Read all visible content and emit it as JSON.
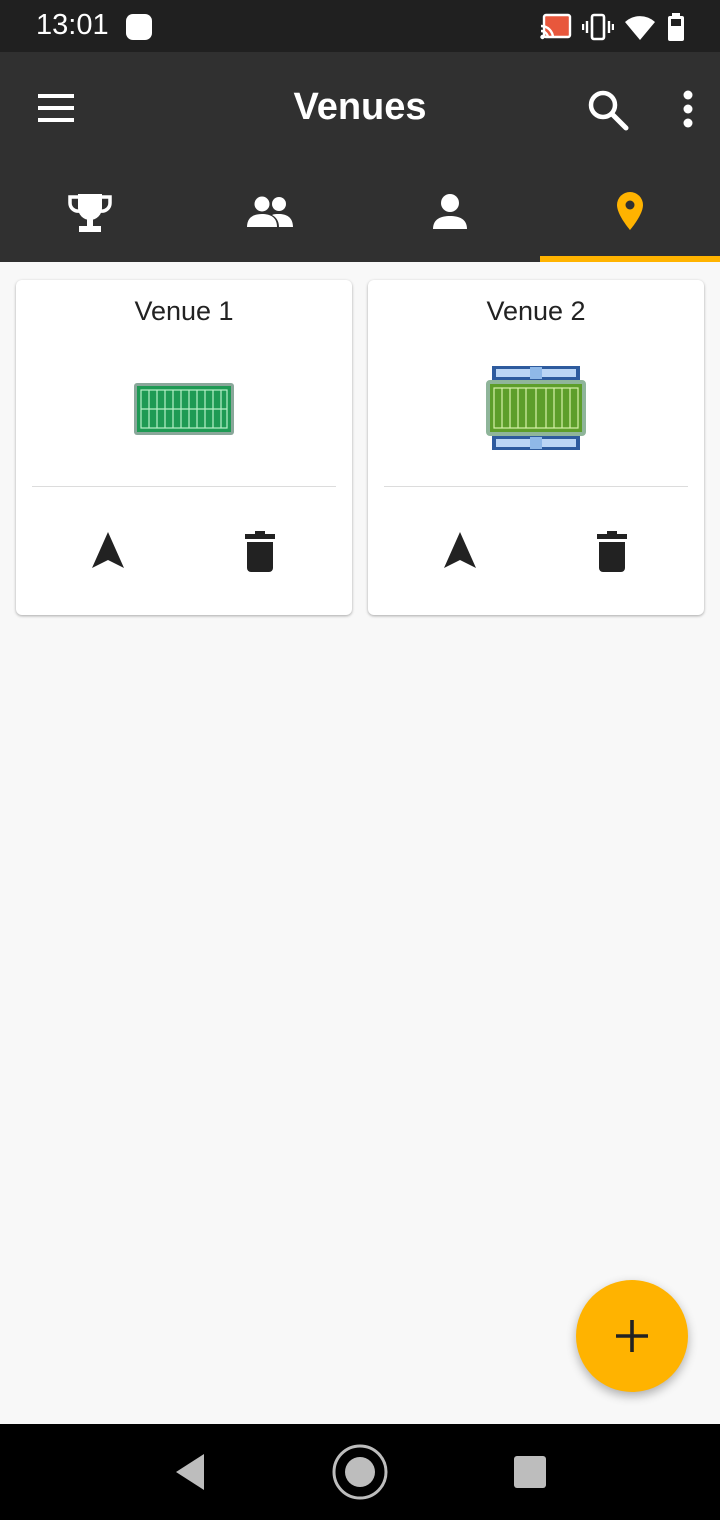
{
  "status_bar": {
    "time": "13:01"
  },
  "app_bar": {
    "title": "Venues"
  },
  "tabs": [
    {
      "icon": "trophy-icon",
      "active": false
    },
    {
      "icon": "group-icon",
      "active": false
    },
    {
      "icon": "person-icon",
      "active": false
    },
    {
      "icon": "location-pin-icon",
      "active": true
    }
  ],
  "venues": [
    {
      "name": "Venue 1",
      "image": "field-icon"
    },
    {
      "name": "Venue 2",
      "image": "stadium-icon"
    }
  ],
  "colors": {
    "accent": "#ffb300",
    "app_bar": "#303030",
    "status_bar": "#202020",
    "background": "#f8f8f8"
  }
}
